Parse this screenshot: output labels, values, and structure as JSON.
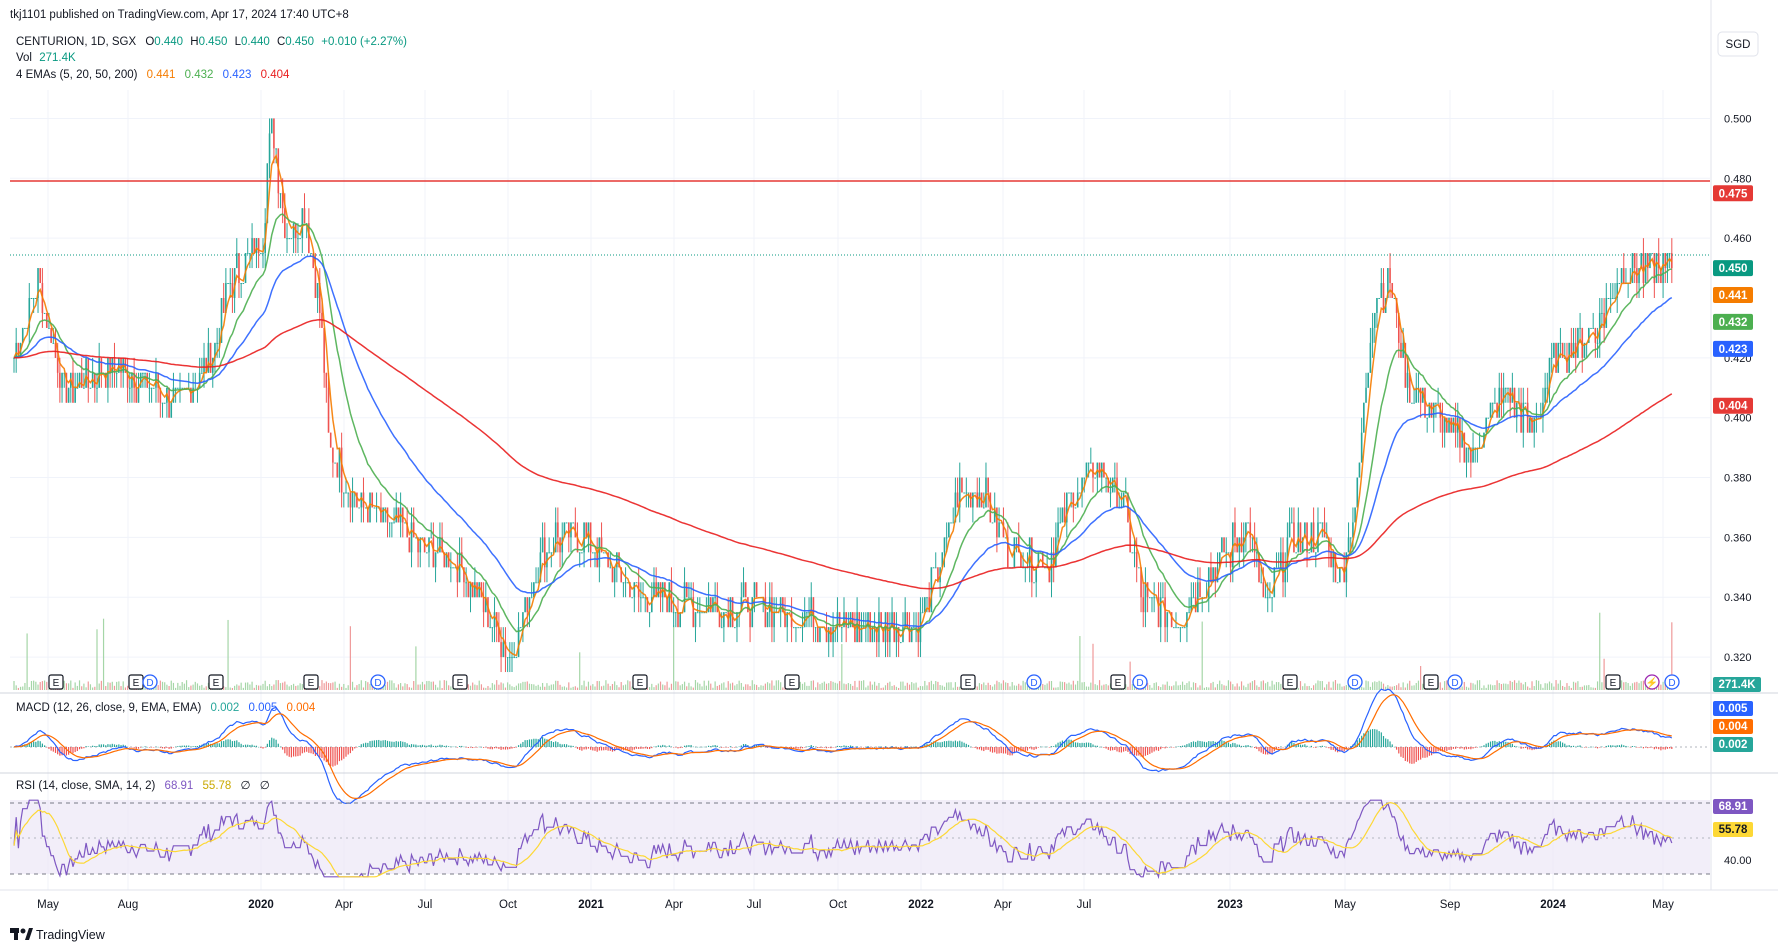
{
  "header": {
    "publisher": "tkj1101 published on TradingView.com, Apr 17, 2024 17:40 UTC+8",
    "currency": "SGD"
  },
  "legend": {
    "symbol": "CENTURION, 1D, SGX",
    "o_label": "O",
    "o_value": "0.440",
    "h_label": "H",
    "h_value": "0.450",
    "l_label": "L",
    "l_value": "0.440",
    "c_label": "C",
    "c_value": "0.450",
    "change": "+0.010 (+2.27%)",
    "vol_label": "Vol",
    "vol_value": "271.4K",
    "ema_label": "4 EMAs (5, 20, 50, 200)",
    "ema_values": [
      "0.441",
      "0.432",
      "0.423",
      "0.404"
    ],
    "macd_label": "MACD (12, 26, close, 9, EMA, EMA)",
    "macd_values": [
      "0.002",
      "0.005",
      "0.004"
    ],
    "rsi_label": "RSI (14, close, SMA, 14, 2)",
    "rsi_values": [
      "68.91",
      "55.78",
      "∅",
      "∅"
    ]
  },
  "colors": {
    "up": "#26a69a",
    "down": "#ef5350",
    "ema5": "#f57c00",
    "ema20": "#4caf50",
    "ema50": "#2962ff",
    "ema200": "#e91e1e",
    "hline": "#e53935",
    "rsi": "#7e57c2",
    "rsi_ma": "#fdd835",
    "macd": "#2962ff",
    "signal": "#ff6d00",
    "close_line": "#089981"
  },
  "chart_data": {
    "type": "candlestick",
    "price_axis_ticks": [
      "0.500",
      "0.480",
      "0.460",
      "0.420",
      "0.400",
      "0.380",
      "0.360",
      "0.340",
      "0.320"
    ],
    "ylim": [
      0.309,
      0.5075
    ],
    "price_labels": [
      "0.475",
      "0.450",
      "0.441",
      "0.432",
      "0.423",
      "0.404"
    ],
    "horizontal_line": 0.475,
    "last_close": 0.45,
    "time_axis_labels": [
      "May",
      "Aug",
      "2020",
      "Apr",
      "Jul",
      "Oct",
      "2021",
      "Apr",
      "Jul",
      "Oct",
      "2022",
      "Apr",
      "Jul",
      "2023",
      "May",
      "Sep",
      "2024",
      "May"
    ],
    "price_path": [
      [
        0.0,
        0.42
      ],
      [
        0.015,
        0.445
      ],
      [
        0.03,
        0.408
      ],
      [
        0.06,
        0.418
      ],
      [
        0.08,
        0.41
      ],
      [
        0.1,
        0.405
      ],
      [
        0.12,
        0.42
      ],
      [
        0.13,
        0.445
      ],
      [
        0.15,
        0.46
      ],
      [
        0.155,
        0.5
      ],
      [
        0.165,
        0.46
      ],
      [
        0.175,
        0.47
      ],
      [
        0.185,
        0.435
      ],
      [
        0.19,
        0.39
      ],
      [
        0.21,
        0.37
      ],
      [
        0.24,
        0.36
      ],
      [
        0.27,
        0.35
      ],
      [
        0.3,
        0.32
      ],
      [
        0.315,
        0.35
      ],
      [
        0.325,
        0.36
      ],
      [
        0.345,
        0.36
      ],
      [
        0.375,
        0.34
      ],
      [
        0.41,
        0.337
      ],
      [
        0.45,
        0.337
      ],
      [
        0.5,
        0.33
      ],
      [
        0.545,
        0.33
      ],
      [
        0.555,
        0.345
      ],
      [
        0.57,
        0.375
      ],
      [
        0.585,
        0.375
      ],
      [
        0.6,
        0.355
      ],
      [
        0.625,
        0.352
      ],
      [
        0.635,
        0.372
      ],
      [
        0.655,
        0.385
      ],
      [
        0.67,
        0.37
      ],
      [
        0.68,
        0.34
      ],
      [
        0.7,
        0.332
      ],
      [
        0.725,
        0.35
      ],
      [
        0.745,
        0.365
      ],
      [
        0.755,
        0.335
      ],
      [
        0.77,
        0.36
      ],
      [
        0.79,
        0.36
      ],
      [
        0.8,
        0.345
      ],
      [
        0.81,
        0.375
      ],
      [
        0.82,
        0.44
      ],
      [
        0.83,
        0.445
      ],
      [
        0.84,
        0.41
      ],
      [
        0.86,
        0.4
      ],
      [
        0.88,
        0.388
      ],
      [
        0.9,
        0.41
      ],
      [
        0.915,
        0.395
      ],
      [
        0.93,
        0.42
      ],
      [
        0.955,
        0.43
      ],
      [
        0.97,
        0.45
      ]
    ],
    "macd_range": [
      -0.009,
      0.018
    ],
    "rsi_levels": [
      80,
      70,
      60,
      50,
      40,
      30
    ],
    "rsi_axis_ticks": [
      "80.00",
      "60.00",
      "40.00"
    ]
  },
  "footer": {
    "brand": "TradingView"
  },
  "events": [
    {
      "label": "E",
      "date": "May"
    },
    {
      "label": "E",
      "date": "Aug"
    },
    {
      "label": "D",
      "date": "Aug"
    },
    {
      "label": "E",
      "date": "Nov"
    },
    {
      "label": "E",
      "date": "Feb"
    },
    {
      "label": "D",
      "date": "May"
    },
    {
      "label": "E",
      "date": "Aug"
    },
    {
      "label": "E",
      "date": "Feb"
    },
    {
      "label": "E",
      "date": "Aug"
    },
    {
      "label": "E",
      "date": "Feb"
    },
    {
      "label": "D",
      "date": "May"
    },
    {
      "label": "E",
      "date": "Aug"
    },
    {
      "label": "D",
      "date": "Aug"
    },
    {
      "label": "E",
      "date": "Feb"
    },
    {
      "label": "D",
      "date": "May"
    },
    {
      "label": "E",
      "date": "Aug"
    },
    {
      "label": "D",
      "date": "Aug"
    },
    {
      "label": "E",
      "date": "Feb"
    },
    {
      "label": "⚡",
      "date": "Apr"
    },
    {
      "label": "D",
      "date": "May"
    }
  ]
}
